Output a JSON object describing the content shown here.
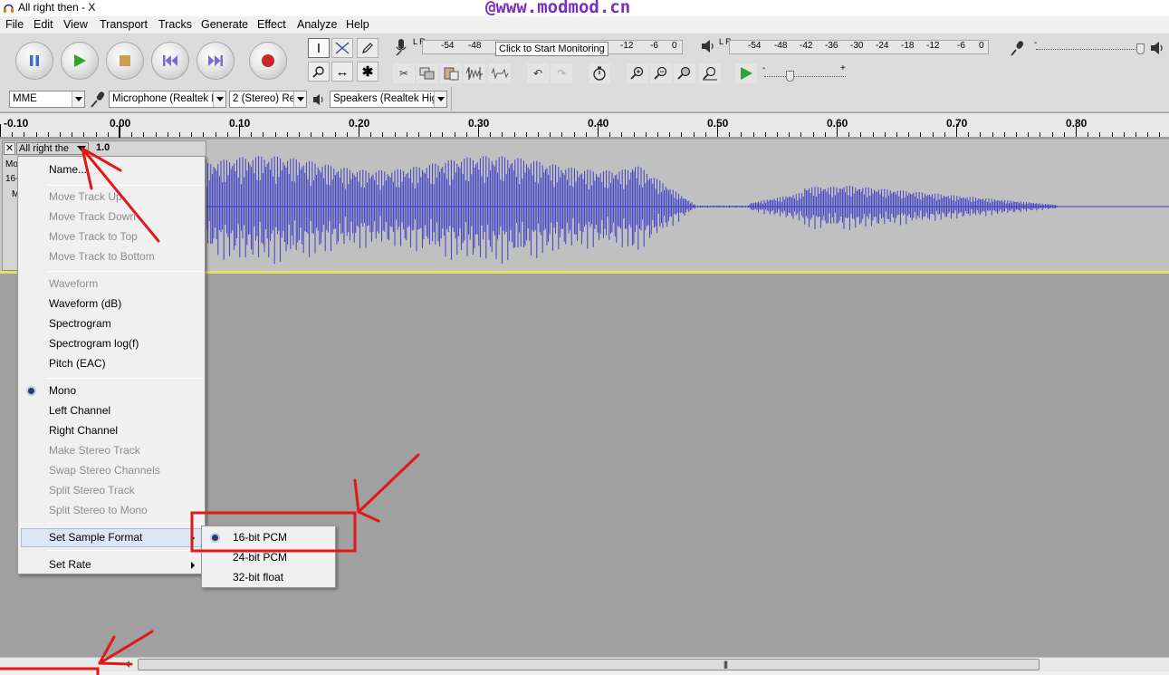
{
  "window": {
    "title": "All right then - X",
    "watermark": "@www.modmod.cn"
  },
  "menubar": {
    "items": [
      "File",
      "Edit",
      "View",
      "Transport",
      "Tracks",
      "Generate",
      "Effect",
      "Analyze",
      "Help"
    ]
  },
  "transport": {
    "buttons": [
      "pause",
      "play",
      "stop",
      "skip-start",
      "skip-end",
      "record"
    ]
  },
  "meters": {
    "record_scale": [
      "-54",
      "-48",
      "",
      "",
      "",
      "",
      "",
      "-12",
      "-6",
      "0"
    ],
    "record_tooltip": "Click to Start Monitoring",
    "record_partial": "8",
    "playback_scale": [
      "-54",
      "-48",
      "-42",
      "-36",
      "-30",
      "-24",
      "-18",
      "-12",
      "-6",
      "0"
    ],
    "record_channel_label": "L R",
    "playback_channel_label": "L R"
  },
  "mixer": {
    "input_slider_label": "-",
    "output_slider_min": "-",
    "output_slider_max": "+"
  },
  "devices": {
    "host": "MME",
    "input": "Microphone (Realtek H",
    "channels": "2 (Stereo) Re",
    "output": "Speakers (Realtek Higl"
  },
  "ruler": {
    "labels": [
      "-0.10",
      "0.00",
      "0.10",
      "0.20",
      "0.30",
      "0.40",
      "0.50",
      "0.60",
      "0.70",
      "0.80"
    ]
  },
  "track": {
    "name": "All right the",
    "close_label": "✕",
    "gain": "1.0",
    "info_line1": "Mo",
    "info_line2": "16-",
    "info_line3": "M"
  },
  "context_menu": {
    "items": [
      {
        "label": "Name...",
        "enabled": true
      },
      {
        "label": "Move Track Up",
        "enabled": false
      },
      {
        "label": "Move Track Down",
        "enabled": false
      },
      {
        "label": "Move Track to Top",
        "enabled": false
      },
      {
        "label": "Move Track to Bottom",
        "enabled": false
      },
      {
        "label": "Waveform",
        "enabled": false
      },
      {
        "label": "Waveform (dB)",
        "enabled": true
      },
      {
        "label": "Spectrogram",
        "enabled": true
      },
      {
        "label": "Spectrogram log(f)",
        "enabled": true
      },
      {
        "label": "Pitch (EAC)",
        "enabled": true
      },
      {
        "label": "Mono",
        "enabled": true,
        "checked": true
      },
      {
        "label": "Left Channel",
        "enabled": true
      },
      {
        "label": "Right Channel",
        "enabled": true
      },
      {
        "label": "Make Stereo Track",
        "enabled": false
      },
      {
        "label": "Swap Stereo Channels",
        "enabled": false
      },
      {
        "label": "Split Stereo Track",
        "enabled": false
      },
      {
        "label": "Split Stereo to Mono",
        "enabled": false
      },
      {
        "label": "Set Sample Format",
        "enabled": true,
        "highlighted": true,
        "submenu": true
      },
      {
        "label": "Set Rate",
        "enabled": true,
        "submenu": true
      }
    ]
  },
  "sample_format_submenu": {
    "items": [
      {
        "label": "16-bit PCM",
        "checked": true
      },
      {
        "label": "24-bit PCM",
        "checked": false
      },
      {
        "label": "32-bit float",
        "checked": false
      }
    ]
  },
  "scrollbar": {
    "grip": "|||"
  },
  "colors": {
    "annotation_red": "#e11818",
    "waveform_blue": "#3232c8",
    "watermark_purple": "#7b2fbf",
    "track_selected_border": "#e6e066"
  }
}
